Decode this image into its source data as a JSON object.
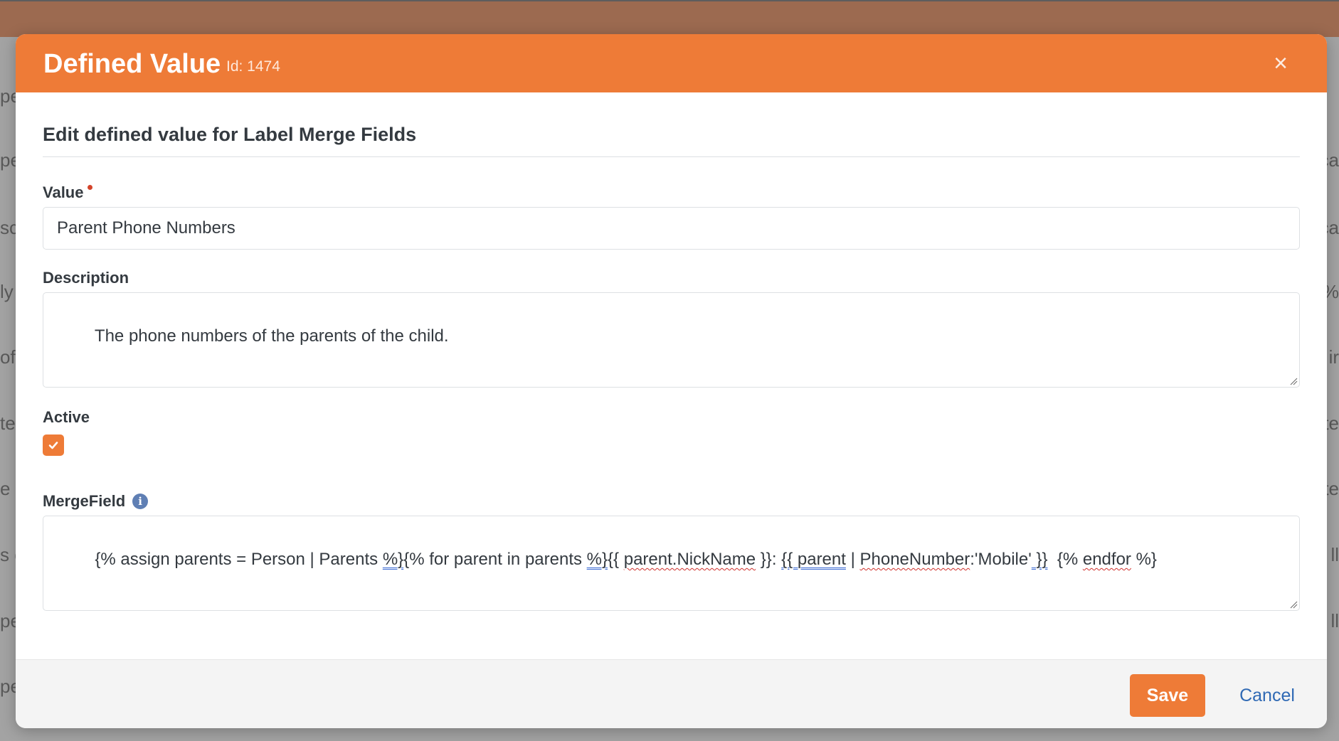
{
  "backdrop": {
    "left_fragments": [
      "pe",
      "pe",
      "sc",
      "ly",
      "of",
      "te",
      "e p",
      "s c",
      "pe",
      "pe"
    ],
    "right_fragments": [
      "ca",
      "ca",
      "%",
      "ir",
      "te",
      "te",
      "ll",
      "ll"
    ]
  },
  "modal": {
    "title": "Defined Value",
    "id_label": "Id: 1474",
    "close_icon": "×",
    "section_title": "Edit defined value for Label Merge Fields"
  },
  "fields": {
    "value": {
      "label": "Value",
      "value": "Parent Phone Numbers"
    },
    "description": {
      "label": "Description",
      "value": "The phone numbers of the parents of the child."
    },
    "active": {
      "label": "Active",
      "checked": true
    },
    "mergefield": {
      "label": "MergeField",
      "info_icon": "i",
      "segments": [
        {
          "text": "{% assign parents = Person | Parents ",
          "style": ""
        },
        {
          "text": "%}",
          "style": "blueline"
        },
        {
          "text": "{% for parent in parents ",
          "style": ""
        },
        {
          "text": "%}",
          "style": "blueline"
        },
        {
          "text": "{{ ",
          "style": ""
        },
        {
          "text": "parent.NickName",
          "style": "squiggle"
        },
        {
          "text": " }}: ",
          "style": ""
        },
        {
          "text": "{{ parent",
          "style": "blueline"
        },
        {
          "text": " | ",
          "style": ""
        },
        {
          "text": "PhoneNumber",
          "style": "squiggle"
        },
        {
          "text": ":'Mobile'",
          "style": ""
        },
        {
          "text": " }}",
          "style": "blueline"
        },
        {
          "text": "  {% ",
          "style": ""
        },
        {
          "text": "endfor",
          "style": "squiggle"
        },
        {
          "text": " %}",
          "style": ""
        }
      ]
    }
  },
  "footer": {
    "save_label": "Save",
    "cancel_label": "Cancel"
  },
  "colors": {
    "accent": "#ee7b37",
    "link": "#2f69b4",
    "required": "#d4442a",
    "info": "#5f7fb4"
  }
}
